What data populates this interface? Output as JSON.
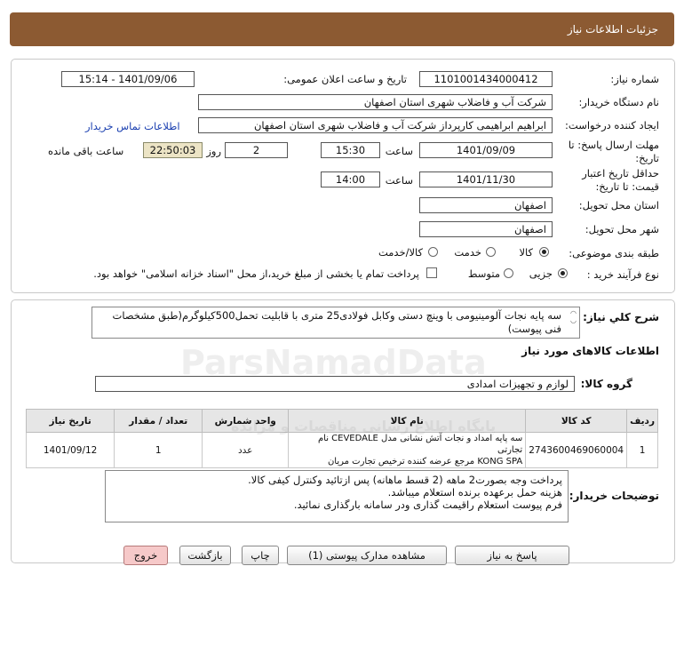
{
  "header": {
    "title": "جزئیات اطلاعات نیاز"
  },
  "details": {
    "need_number_label": "شماره نیاز:",
    "need_number": "1101001434000412",
    "announce_label": "تاریخ و ساعت اعلان عمومی:",
    "announce_value": "1401/09/06 - 15:14",
    "buyer_label": "نام دستگاه خریدار:",
    "buyer": "شرکت آب و فاضلاب شهری استان اصفهان",
    "creator_label": "ایجاد کننده درخواست:",
    "creator": "ابراهیم ابراهیمی کارپرداز شرکت آب و فاضلاب شهری استان اصفهان",
    "contact_link": "اطلاعات تماس خریدار",
    "deadline_label_1": "مهلت ارسال پاسخ: تا",
    "deadline_label_2": "تاریخ:",
    "deadline_date": "1401/09/09",
    "time_label": "ساعت",
    "deadline_time": "15:30",
    "days": "2",
    "days_label": "روز و",
    "remaining": "22:50:03",
    "remaining_label": "ساعت باقی مانده",
    "validity_label_1": "حداقل تاریخ اعتبار",
    "validity_label_2": "قیمت: تا تاریخ:",
    "validity_date": "1401/11/30",
    "validity_time": "14:00",
    "province_label": "استان محل تحویل:",
    "province": "اصفهان",
    "city_label": "شهر محل تحویل:",
    "city": "اصفهان",
    "category_label": "طبقه بندی موضوعی:",
    "category_options": [
      "کالا",
      "خدمت",
      "کالا/خدمت"
    ],
    "category_selected": 0,
    "process_label": "نوع فرآیند خرید :",
    "process_options": [
      "جزیی",
      "متوسط"
    ],
    "process_selected": 0,
    "payment_note": "پرداخت تمام یا بخشی از مبلغ خرید،از محل \"اسناد خزانه اسلامی\" خواهد بود."
  },
  "summary": {
    "label": "شرح کلي نياز:",
    "text": "سه پایه نجات آلومینیومی با وینچ دستی وکابل فولادی25 متری با قابلیت تحمل500کیلوگرم(طبق مشخصات فنی پیوست)"
  },
  "goods": {
    "section_title": "اطلاعات کالاهای مورد نیاز",
    "group_label": "گروه کالا:",
    "group": "لوازم و تجهیزات امدادی",
    "columns": [
      "ردیف",
      "کد کالا",
      "نام کالا",
      "واحد شمارش",
      "تعداد / مقدار",
      "تاریخ نیاز"
    ],
    "rows": [
      {
        "row": "1",
        "code": "2743600469060004",
        "name_line1": "سه پایه امداد و نجات آتش نشانی مدل CEVEDALE نام تجارتی",
        "name_line2": "KONG SPA مرجع عرضه کننده ترخیص تجارت مریان",
        "unit": "عدد",
        "qty": "1",
        "date": "1401/09/12"
      }
    ]
  },
  "notes": {
    "label": "توضیحات خریدار:",
    "line1": "پرداخت وجه بصورت2 ماهه (2 قسط ماهانه) پس ازتائید وکنترل کیفی کالا.",
    "line2": "هزینه حمل برعهده برنده استعلام میباشد.",
    "line3": "فرم پیوست استعلام راقیمت گذاری ودر سامانه بارگذاری نمائید."
  },
  "buttons": {
    "reply": "پاسخ به نیاز",
    "attachments": "مشاهده مدارک پیوستی (1)",
    "print": "چاپ",
    "back": "بازگشت",
    "exit": "خروج"
  },
  "watermark": {
    "brand": "ParsNamadData",
    "fa": "پایگاه اطلاع رسانی مناقصات و مزایده"
  },
  "colors": {
    "header_bg": "#8c5a32",
    "link": "#1a3fb0",
    "remaining_bg": "#ece4c5",
    "exit_bg": "#f6c9c9"
  }
}
